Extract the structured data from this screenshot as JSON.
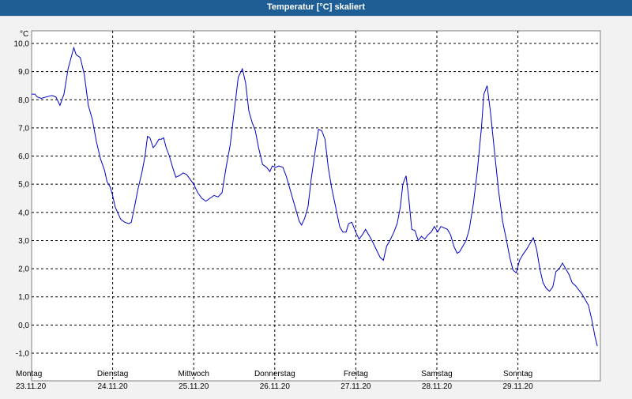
{
  "window": {
    "title": "Temperatur [°C] skaliert"
  },
  "colors": {
    "titlebar": "#1e5e94",
    "background": "#f2f2f2",
    "grid": "#000000",
    "line": "#0000cc"
  },
  "chart_data": {
    "type": "line",
    "title": "Temperatur [°C] skaliert",
    "ylabel": "°C",
    "xlabel": "",
    "ylim": [
      -1.0,
      10.0
    ],
    "y_ticks": [
      "10,0",
      "9,0",
      "8,0",
      "7,0",
      "6,0",
      "5,0",
      "4,0",
      "3,0",
      "2,0",
      "1,0",
      "0,0",
      "-1,0"
    ],
    "y_tick_values": [
      10,
      9,
      8,
      7,
      6,
      5,
      4,
      3,
      2,
      1,
      0,
      -1
    ],
    "x_unit": "days since Monday 23.11.20 00:00",
    "xlim": [
      0,
      7.05
    ],
    "grid": true,
    "legend": "none",
    "x_labels": [
      {
        "day": "Montag",
        "date": "23.11.20",
        "x": 0
      },
      {
        "day": "Dienstag",
        "date": "24.11.20",
        "x": 1
      },
      {
        "day": "Mittwoch",
        "date": "25.11.20",
        "x": 2
      },
      {
        "day": "Donnerstag",
        "date": "26.11.20",
        "x": 3
      },
      {
        "day": "Freitag",
        "date": "27.11.20",
        "x": 4
      },
      {
        "day": "Samstag",
        "date": "28.11.20",
        "x": 5
      },
      {
        "day": "Sonntag",
        "date": "29.11.20",
        "x": 6
      }
    ],
    "series": [
      {
        "name": "",
        "points": [
          [
            0.0,
            8.2
          ],
          [
            0.04,
            8.2
          ],
          [
            0.07,
            8.1
          ],
          [
            0.12,
            8.05
          ],
          [
            0.18,
            8.1
          ],
          [
            0.25,
            8.15
          ],
          [
            0.3,
            8.1
          ],
          [
            0.35,
            7.8
          ],
          [
            0.4,
            8.2
          ],
          [
            0.45,
            9.1
          ],
          [
            0.52,
            9.85
          ],
          [
            0.55,
            9.6
          ],
          [
            0.6,
            9.5
          ],
          [
            0.65,
            8.9
          ],
          [
            0.7,
            7.8
          ],
          [
            0.75,
            7.3
          ],
          [
            0.8,
            6.5
          ],
          [
            0.85,
            5.9
          ],
          [
            0.9,
            5.5
          ],
          [
            0.93,
            5.1
          ],
          [
            0.97,
            4.9
          ],
          [
            1.0,
            4.6
          ],
          [
            1.03,
            4.2
          ],
          [
            1.06,
            4.0
          ],
          [
            1.1,
            3.75
          ],
          [
            1.15,
            3.65
          ],
          [
            1.2,
            3.6
          ],
          [
            1.23,
            3.65
          ],
          [
            1.27,
            4.2
          ],
          [
            1.31,
            4.8
          ],
          [
            1.36,
            5.4
          ],
          [
            1.4,
            6.0
          ],
          [
            1.43,
            6.7
          ],
          [
            1.46,
            6.65
          ],
          [
            1.5,
            6.3
          ],
          [
            1.53,
            6.4
          ],
          [
            1.57,
            6.6
          ],
          [
            1.6,
            6.6
          ],
          [
            1.63,
            6.65
          ],
          [
            1.66,
            6.3
          ],
          [
            1.7,
            6.0
          ],
          [
            1.74,
            5.6
          ],
          [
            1.78,
            5.25
          ],
          [
            1.82,
            5.3
          ],
          [
            1.87,
            5.4
          ],
          [
            1.91,
            5.35
          ],
          [
            1.95,
            5.2
          ],
          [
            2.0,
            5.0
          ],
          [
            2.05,
            4.7
          ],
          [
            2.1,
            4.5
          ],
          [
            2.15,
            4.4
          ],
          [
            2.2,
            4.5
          ],
          [
            2.25,
            4.6
          ],
          [
            2.3,
            4.55
          ],
          [
            2.35,
            4.7
          ],
          [
            2.4,
            5.6
          ],
          [
            2.45,
            6.4
          ],
          [
            2.5,
            7.6
          ],
          [
            2.55,
            8.8
          ],
          [
            2.6,
            9.1
          ],
          [
            2.64,
            8.6
          ],
          [
            2.68,
            7.6
          ],
          [
            2.72,
            7.2
          ],
          [
            2.76,
            6.9
          ],
          [
            2.8,
            6.3
          ],
          [
            2.85,
            5.7
          ],
          [
            2.9,
            5.6
          ],
          [
            2.94,
            5.45
          ],
          [
            2.97,
            5.65
          ],
          [
            3.01,
            5.6
          ],
          [
            3.05,
            5.65
          ],
          [
            3.1,
            5.6
          ],
          [
            3.14,
            5.3
          ],
          [
            3.18,
            4.9
          ],
          [
            3.22,
            4.5
          ],
          [
            3.26,
            4.1
          ],
          [
            3.3,
            3.7
          ],
          [
            3.33,
            3.55
          ],
          [
            3.37,
            3.8
          ],
          [
            3.41,
            4.2
          ],
          [
            3.45,
            5.2
          ],
          [
            3.5,
            6.2
          ],
          [
            3.54,
            6.95
          ],
          [
            3.58,
            6.9
          ],
          [
            3.62,
            6.6
          ],
          [
            3.66,
            5.6
          ],
          [
            3.7,
            4.9
          ],
          [
            3.75,
            4.2
          ],
          [
            3.8,
            3.5
          ],
          [
            3.84,
            3.3
          ],
          [
            3.88,
            3.3
          ],
          [
            3.91,
            3.6
          ],
          [
            3.95,
            3.65
          ],
          [
            4.0,
            3.3
          ],
          [
            4.04,
            3.05
          ],
          [
            4.08,
            3.2
          ],
          [
            4.12,
            3.4
          ],
          [
            4.16,
            3.2
          ],
          [
            4.2,
            3.0
          ],
          [
            4.25,
            2.7
          ],
          [
            4.3,
            2.4
          ],
          [
            4.34,
            2.3
          ],
          [
            4.38,
            2.8
          ],
          [
            4.42,
            3.0
          ],
          [
            4.47,
            3.3
          ],
          [
            4.51,
            3.6
          ],
          [
            4.55,
            4.2
          ],
          [
            4.58,
            5.0
          ],
          [
            4.62,
            5.3
          ],
          [
            4.65,
            4.6
          ],
          [
            4.69,
            3.4
          ],
          [
            4.73,
            3.35
          ],
          [
            4.77,
            3.0
          ],
          [
            4.81,
            3.15
          ],
          [
            4.85,
            3.05
          ],
          [
            4.89,
            3.2
          ],
          [
            4.93,
            3.3
          ],
          [
            4.97,
            3.5
          ],
          [
            5.01,
            3.3
          ],
          [
            5.05,
            3.5
          ],
          [
            5.09,
            3.45
          ],
          [
            5.13,
            3.4
          ],
          [
            5.17,
            3.2
          ],
          [
            5.21,
            2.8
          ],
          [
            5.25,
            2.55
          ],
          [
            5.28,
            2.6
          ],
          [
            5.32,
            2.8
          ],
          [
            5.36,
            3.0
          ],
          [
            5.4,
            3.4
          ],
          [
            5.45,
            4.3
          ],
          [
            5.5,
            5.5
          ],
          [
            5.55,
            7.0
          ],
          [
            5.58,
            8.2
          ],
          [
            5.62,
            8.5
          ],
          [
            5.66,
            7.6
          ],
          [
            5.71,
            6.2
          ],
          [
            5.76,
            4.8
          ],
          [
            5.81,
            3.7
          ],
          [
            5.86,
            3.0
          ],
          [
            5.9,
            2.4
          ],
          [
            5.94,
            1.95
          ],
          [
            5.98,
            1.85
          ],
          [
            6.02,
            2.3
          ],
          [
            6.06,
            2.5
          ],
          [
            6.11,
            2.7
          ],
          [
            6.15,
            2.9
          ],
          [
            6.19,
            3.1
          ],
          [
            6.23,
            2.7
          ],
          [
            6.27,
            2.0
          ],
          [
            6.31,
            1.5
          ],
          [
            6.35,
            1.3
          ],
          [
            6.39,
            1.2
          ],
          [
            6.43,
            1.35
          ],
          [
            6.47,
            1.9
          ],
          [
            6.51,
            2.0
          ],
          [
            6.55,
            2.2
          ],
          [
            6.59,
            2.0
          ],
          [
            6.63,
            1.8
          ],
          [
            6.67,
            1.5
          ],
          [
            6.71,
            1.4
          ],
          [
            6.75,
            1.25
          ],
          [
            6.79,
            1.1
          ],
          [
            6.83,
            0.9
          ],
          [
            6.87,
            0.7
          ],
          [
            6.91,
            0.2
          ],
          [
            6.95,
            -0.4
          ],
          [
            6.98,
            -0.75
          ]
        ]
      }
    ]
  }
}
